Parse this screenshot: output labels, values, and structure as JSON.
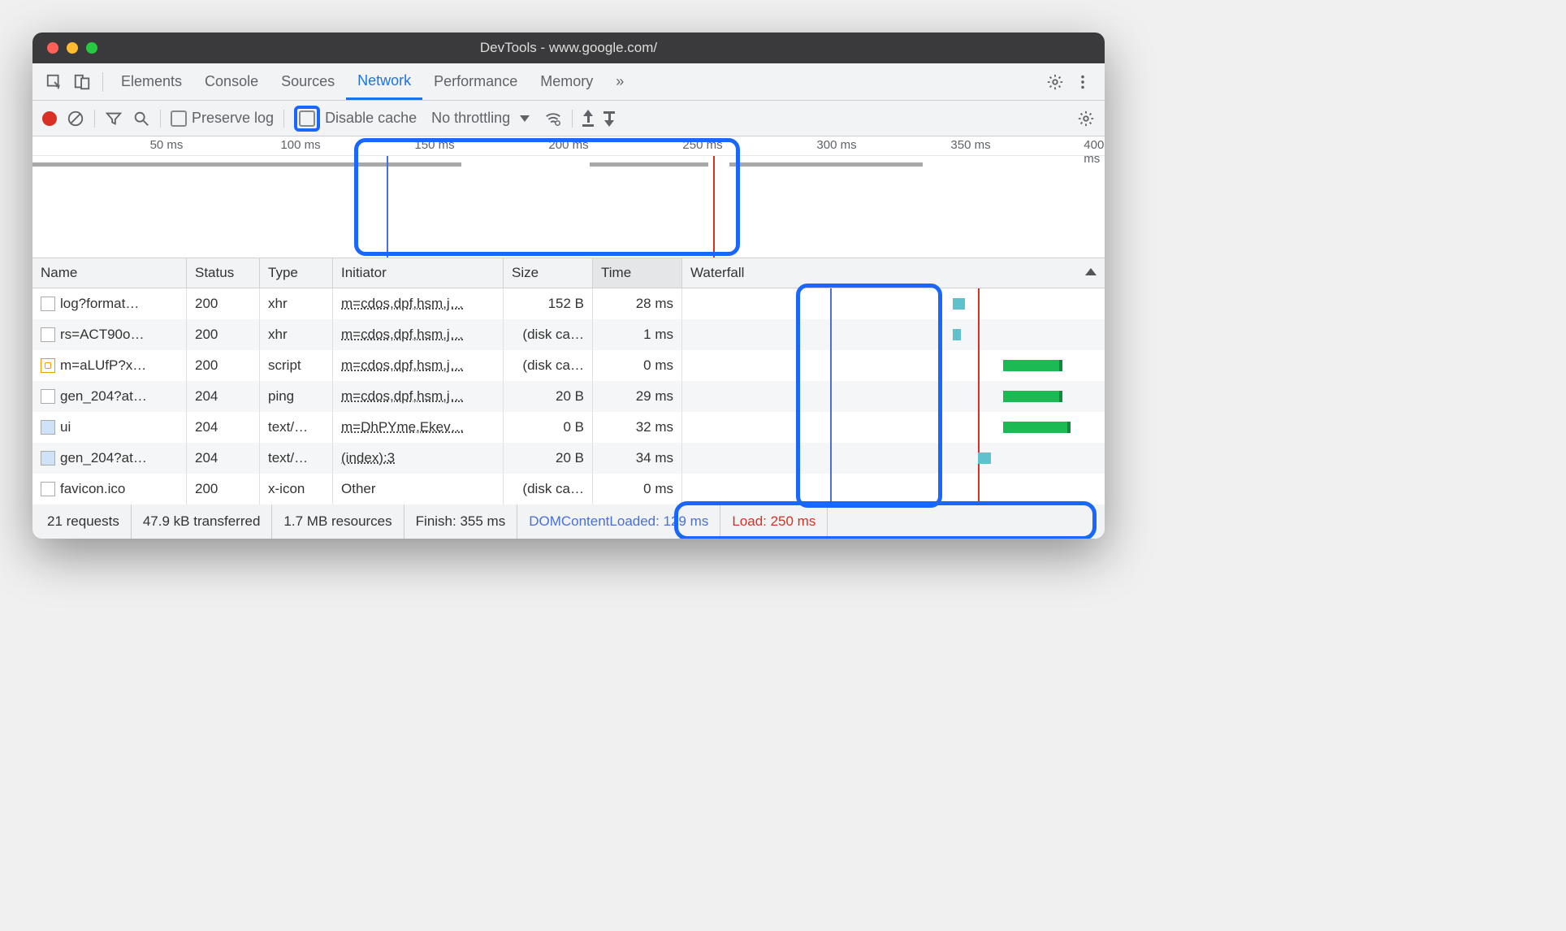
{
  "window": {
    "title": "DevTools - www.google.com/"
  },
  "tabs": {
    "items": [
      "Elements",
      "Console",
      "Sources",
      "Network",
      "Performance",
      "Memory"
    ],
    "more": "»",
    "active": "Network"
  },
  "toolbar": {
    "preserve_log": "Preserve log",
    "disable_cache": "Disable cache",
    "throttling": "No throttling"
  },
  "timeline": {
    "ticks": [
      "50 ms",
      "100 ms",
      "150 ms",
      "200 ms",
      "250 ms",
      "300 ms",
      "350 ms",
      "400 ms"
    ]
  },
  "columns": {
    "name": "Name",
    "status": "Status",
    "type": "Type",
    "initiator": "Initiator",
    "size": "Size",
    "time": "Time",
    "waterfall": "Waterfall"
  },
  "rows": [
    {
      "name": "log?format…",
      "status": "200",
      "type": "xhr",
      "initiator": "m=cdos,dpf,hsm,j…",
      "size": "152 B",
      "time": "28 ms",
      "icon": "doc"
    },
    {
      "name": "rs=ACT90o…",
      "status": "200",
      "type": "xhr",
      "initiator": "m=cdos,dpf,hsm,j…",
      "size": "(disk ca…",
      "time": "1 ms",
      "icon": "doc"
    },
    {
      "name": "m=aLUfP?x…",
      "status": "200",
      "type": "script",
      "initiator": "m=cdos,dpf,hsm,j…",
      "size": "(disk ca…",
      "time": "0 ms",
      "icon": "js"
    },
    {
      "name": "gen_204?at…",
      "status": "204",
      "type": "ping",
      "initiator": "m=cdos,dpf,hsm,j…",
      "size": "20 B",
      "time": "29 ms",
      "icon": "doc"
    },
    {
      "name": "ui",
      "status": "204",
      "type": "text/…",
      "initiator": "m=DhPYme,Ekev…",
      "size": "0 B",
      "time": "32 ms",
      "icon": "img"
    },
    {
      "name": "gen_204?at…",
      "status": "204",
      "type": "text/…",
      "initiator": "(index):3",
      "size": "20 B",
      "time": "34 ms",
      "icon": "img"
    },
    {
      "name": "favicon.ico",
      "status": "200",
      "type": "x-icon",
      "initiator": "Other",
      "size": "(disk ca…",
      "time": "0 ms",
      "icon": "doc"
    }
  ],
  "footer": {
    "requests": "21 requests",
    "transferred": "47.9 kB transferred",
    "resources": "1.7 MB resources",
    "finish": "Finish: 355 ms",
    "dcl": "DOMContentLoaded: 129 ms",
    "load": "Load: 250 ms"
  }
}
